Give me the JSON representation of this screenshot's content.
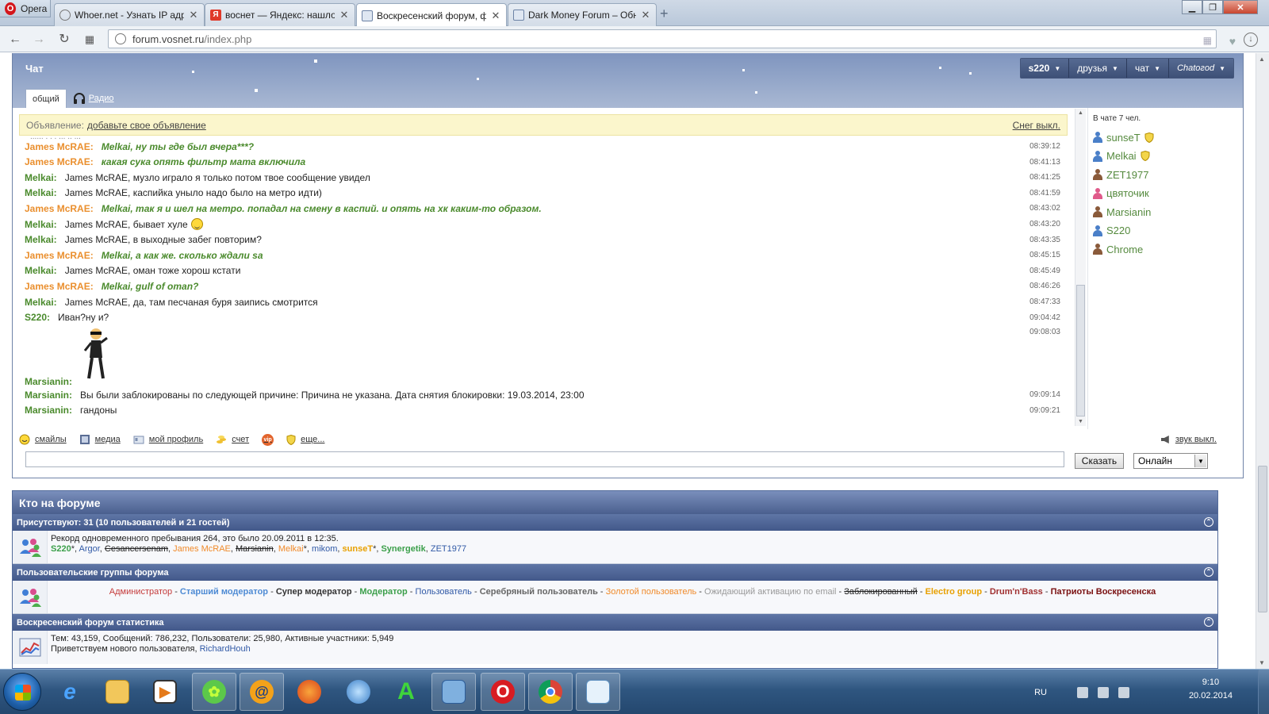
{
  "browser": {
    "menu_label": "Opera",
    "tabs": [
      {
        "title": "Whoer.net - Узнать IP адрес",
        "favicon": "search-icon",
        "active": false
      },
      {
        "title": "воснет — Яндекс: нашлось",
        "favicon": "yandex-icon",
        "active": false
      },
      {
        "title": "Воскресенский форум, ф",
        "favicon": "forum-icon",
        "active": true
      },
      {
        "title": "Dark Money Forum – Обн",
        "favicon": "forum-icon",
        "active": false
      }
    ],
    "new_tab": "+",
    "url": "forum.vosnet.ru/index.php",
    "url_dim": "/index.php",
    "url_host": "forum.vosnet.ru"
  },
  "chat": {
    "title": "Чат",
    "menu": {
      "user": "s220",
      "friends": "друзья",
      "chat": "чат",
      "chatogod": "Chatoгod"
    },
    "tabs": {
      "general": "общий",
      "radio": "Радио"
    },
    "announcement": {
      "label": "Объявление:",
      "link": "добавьте свое объявление",
      "snow_off": "Снег выкл."
    },
    "messages": [
      {
        "nick": "James McRAE:",
        "text": "Melkai, ну ты где был вчера***?",
        "time": "08:39:12",
        "nick_color": "orange",
        "style": "em"
      },
      {
        "nick": "James McRAE:",
        "text": "какая сука опять фильтр мата включила",
        "time": "08:41:13",
        "nick_color": "orange",
        "style": "em"
      },
      {
        "nick": "Melkai:",
        "text": "James McRAE, музло играло я только потом твое сообщение увидел",
        "time": "08:41:25",
        "nick_color": "green",
        "style": "plain"
      },
      {
        "nick": "Melkai:",
        "text": "James McRAE, каспийка уныло надо было на метро идти)",
        "time": "08:41:59",
        "nick_color": "green",
        "style": "plain"
      },
      {
        "nick": "James McRAE:",
        "text": "Melkai, так я и шел на метро. попадал на смену в каспий. и опять на хк каким-то образом.",
        "time": "08:43:02",
        "nick_color": "orange",
        "style": "em"
      },
      {
        "nick": "Melkai:",
        "text": "James McRAE, бывает хуле",
        "time": "08:43:20",
        "nick_color": "green",
        "style": "plain",
        "smiley": true
      },
      {
        "nick": "Melkai:",
        "text": "James McRAE, в выходные забег повторим?",
        "time": "08:43:35",
        "nick_color": "green",
        "style": "plain"
      },
      {
        "nick": "James McRAE:",
        "text": "Melkai, а как же. сколько ждали sa",
        "time": "08:45:15",
        "nick_color": "orange",
        "style": "em"
      },
      {
        "nick": "Melkai:",
        "text": "James McRAE, оман тоже хорош кстати",
        "time": "08:45:49",
        "nick_color": "green",
        "style": "plain"
      },
      {
        "nick": "James McRAE:",
        "text": "Melkai, gulf of oman?",
        "time": "08:46:26",
        "nick_color": "orange",
        "style": "em"
      },
      {
        "nick": "Melkai:",
        "text": "James McRAE, да, там песчаная буря заипись смотрится",
        "time": "08:47:33",
        "nick_color": "green",
        "style": "plain"
      },
      {
        "nick": "S220:",
        "text": "Иван?ну и?",
        "time": "09:04:42",
        "nick_color": "green",
        "style": "plain"
      },
      {
        "nick": "Marsianin:",
        "text": "",
        "time": "09:08:03",
        "nick_color": "green",
        "style": "plain",
        "dancer": true
      },
      {
        "nick": "Marsianin:",
        "text": "Вы были заблокированы по следующей причине: Причина не указана. Дата снятия блокировки: 19.03.2014, 23:00",
        "time": "09:09:14",
        "nick_color": "green",
        "style": "plain"
      },
      {
        "nick": "Marsianin:",
        "text": "гандоны",
        "time": "09:09:21",
        "nick_color": "green",
        "style": "plain"
      }
    ],
    "users_count": "В чате 7 чел.",
    "users": [
      {
        "name": "sunseT",
        "icon_color": "#4a7fc8",
        "shield": true
      },
      {
        "name": "Melkai",
        "icon_color": "#4a7fc8",
        "shield": true
      },
      {
        "name": "ZET1977",
        "icon_color": "#8a5a3a",
        "shield": false
      },
      {
        "name": "цвяточик",
        "icon_color": "#e05a8a",
        "shield": false
      },
      {
        "name": "Marsianin",
        "icon_color": "#8a5a3a",
        "shield": false
      },
      {
        "name": "S220",
        "icon_color": "#4a7fc8",
        "shield": false
      },
      {
        "name": "Chrome",
        "icon_color": "#8a5a3a",
        "shield": false
      }
    ],
    "toolbar": {
      "smileys": "смайлы",
      "media": "медиа",
      "profile": "мой профиль",
      "account": "счет",
      "vip": "vip",
      "more": "еще...",
      "sound_off": "звук выкл."
    },
    "say_button": "Сказать",
    "status": "Онлайн"
  },
  "who": {
    "title": "Кто на форуме",
    "present": "Присутствуют: 31 (10 пользователей и 21 гостей)",
    "record": "Рекорд одновременного пребывания 264, это было 20.09.2011 в 12:35.",
    "online_users": [
      {
        "name": "S220",
        "class": "u-mod",
        "suffix": "*"
      },
      {
        "name": "Argor",
        "class": "u-user",
        "suffix": ""
      },
      {
        "name": "Cesancersenam",
        "class": "u-ban",
        "suffix": ""
      },
      {
        "name": "James McRAE",
        "class": "u-gold",
        "suffix": ""
      },
      {
        "name": "Marsianin",
        "class": "u-ban",
        "suffix": ""
      },
      {
        "name": "Melkai",
        "class": "u-gold",
        "suffix": "*"
      },
      {
        "name": "mikom",
        "class": "u-user",
        "suffix": ""
      },
      {
        "name": "sunseT",
        "class": "u-electro",
        "suffix": "*"
      },
      {
        "name": "Synergetik",
        "class": "u-mod",
        "suffix": ""
      },
      {
        "name": "ZET1977",
        "class": "u-user",
        "suffix": ""
      }
    ],
    "groups_title": "Пользовательские группы форума",
    "groups": [
      {
        "name": "Администратор",
        "class": "u-admin"
      },
      {
        "name": "Старший модератор",
        "class": "u-smod"
      },
      {
        "name": "Супер модератор",
        "class": "u-sup"
      },
      {
        "name": "Модератор",
        "class": "u-mod"
      },
      {
        "name": "Пользователь",
        "class": "u-user"
      },
      {
        "name": "Серебряный пользователь",
        "class": "u-silver"
      },
      {
        "name": "Золотой пользователь",
        "class": "u-gold"
      },
      {
        "name": "Ожидающий активацию по email",
        "class": "u-wait"
      },
      {
        "name": "Заблокированный",
        "class": "u-ban"
      },
      {
        "name": "Electro group",
        "class": "u-electro"
      },
      {
        "name": "Drum'n'Bass",
        "class": "u-dnb"
      },
      {
        "name": "Патриоты Воскресенска",
        "class": "u-patri"
      }
    ],
    "stats_title": "Воскресенский форум статистика",
    "stats": "Тем: 43,159, Сообщений: 786,232, Пользователи: 25,980, Активные участники: 5,949",
    "welcome": "Приветствуем нового пользователя,",
    "newest_user": "RichardHouh"
  },
  "taskbar": {
    "lang": "RU",
    "time": "9:10",
    "date": "20.02.2014"
  }
}
